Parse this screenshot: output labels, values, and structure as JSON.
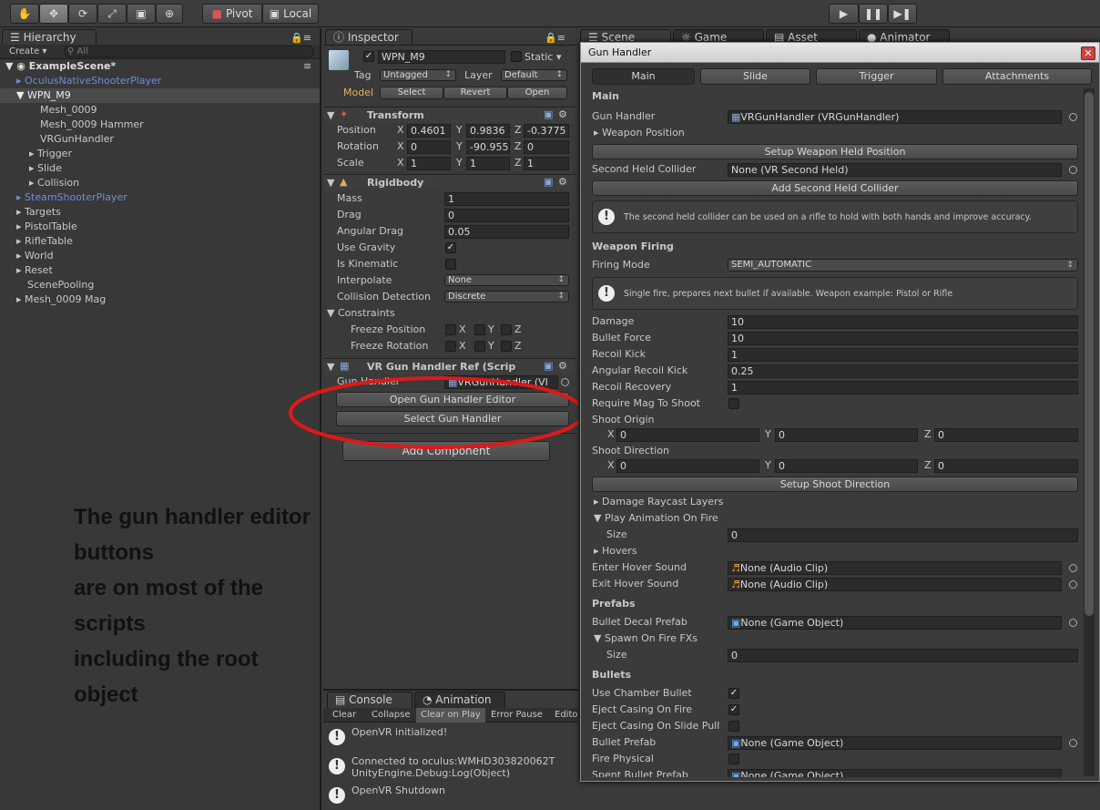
{
  "toolbar": {
    "pivot": "Pivot",
    "local": "Local"
  },
  "hierarchy": {
    "tab": "Hierarchy",
    "create": "Create ▾",
    "search_placeholder": "All",
    "scene": "ExampleScene*",
    "items": [
      "OculusNativeShooterPlayer",
      "WPN_M9",
      "Mesh_0009",
      "Mesh_0009 Hammer",
      "VRGunHandler",
      "Trigger",
      "Slide",
      "Collision",
      "SteamShooterPlayer",
      "Targets",
      "PistolTable",
      "RifleTable",
      "World",
      "Reset",
      "ScenePooling",
      "Mesh_0009 Mag"
    ]
  },
  "inspector": {
    "tab": "Inspector",
    "object_name": "WPN_M9",
    "static": "Static",
    "tag_label": "Tag",
    "tag_value": "Untagged",
    "layer_label": "Layer",
    "layer_value": "Default",
    "model": "Model",
    "select": "Select",
    "revert": "Revert",
    "open": "Open",
    "transform": {
      "title": "Transform",
      "position": "Position",
      "rotation": "Rotation",
      "scale": "Scale",
      "px": "0.4601",
      "py": "0.9836",
      "pz": "-0.3775",
      "rx": "0",
      "ry": "-90.955",
      "rz": "0",
      "sx": "1",
      "sy": "1",
      "sz": "1",
      "x": "X",
      "y": "Y",
      "z": "Z"
    },
    "rigidbody": {
      "title": "Rigidbody",
      "mass": "Mass",
      "mass_v": "1",
      "drag": "Drag",
      "drag_v": "0",
      "angular_drag": "Angular Drag",
      "angular_drag_v": "0.05",
      "use_gravity": "Use Gravity",
      "is_kinematic": "Is Kinematic",
      "interpolate": "Interpolate",
      "interpolate_v": "None",
      "collision": "Collision Detection",
      "collision_v": "Discrete",
      "constraints": "Constraints",
      "freeze_pos": "Freeze Position",
      "freeze_rot": "Freeze Rotation"
    },
    "ref": {
      "title": "VR Gun Handler Ref (Scrip",
      "gun_handler": "Gun Handler",
      "gun_handler_v": "VRGunHandler (VI",
      "open_editor": "Open Gun Handler Editor",
      "select_handler": "Select Gun Handler"
    },
    "add_component": "Add Component"
  },
  "annotation": {
    "line1": "The gun handler editor buttons",
    "line2": "are on most of the scripts",
    "line3": "including the root object"
  },
  "console": {
    "tab1": "Console",
    "tab2": "Animation",
    "clear": "Clear",
    "collapse": "Collapse",
    "clear_on_play": "Clear on Play",
    "error_pause": "Error Pause",
    "editor": "Edito",
    "msg1": "OpenVR initialized!",
    "msg2a": "Connected to oculus:WMHD303820062T",
    "msg2b": "UnityEngine.Debug:Log(Object)",
    "msg3": "OpenVR Shutdown"
  },
  "scene_tabs": {
    "scene": "Scene",
    "game": "Game",
    "asset_store": "Asset Store",
    "animator": "Animator"
  },
  "gun_window": {
    "title": "Gun Handler",
    "tabs": [
      "Main",
      "Slide",
      "Trigger",
      "Attachments"
    ],
    "main_header": "Main",
    "gun_handler": "Gun Handler",
    "gun_handler_v": "VRGunHandler (VRGunHandler)",
    "weapon_position": "Weapon Position",
    "setup_weapon": "Setup Weapon Held Position",
    "second_collider": "Second Held Collider",
    "second_collider_v": "None (VR Second Held)",
    "add_second": "Add Second Held Collider",
    "help1": "The second held collider can be used on a rifle to hold with both hands and improve accuracy.",
    "firing_header": "Weapon Firing",
    "firing_mode": "Firing Mode",
    "firing_mode_v": "SEMI_AUTOMATIC",
    "help2": "Single fire, prepares next bullet if available. Weapon example: Pistol or Rifle",
    "damage": "Damage",
    "damage_v": "10",
    "bullet_force": "Bullet Force",
    "bullet_force_v": "10",
    "recoil_kick": "Recoil Kick",
    "recoil_kick_v": "1",
    "angular_recoil": "Angular Recoil Kick",
    "angular_recoil_v": "0.25",
    "recoil_recovery": "Recoil Recovery",
    "recoil_recovery_v": "1",
    "require_mag": "Require Mag To Shoot",
    "shoot_origin": "Shoot Origin",
    "shoot_direction": "Shoot Direction",
    "zero": "0",
    "setup_shoot": "Setup Shoot Direction",
    "damage_layers": "Damage Raycast Layers",
    "play_anim": "Play Animation On Fire",
    "size": "Size",
    "hovers": "Hovers",
    "enter_hover": "Enter Hover Sound",
    "exit_hover": "Exit Hover Sound",
    "audio_none": "None (Audio Clip)",
    "prefabs_header": "Prefabs",
    "bullet_decal": "Bullet Decal Prefab",
    "go_none": "None (Game Object)",
    "spawn_fx": "Spawn On Fire FXs",
    "bullets_header": "Bullets",
    "chamber": "Use Chamber Bullet",
    "eject_fire": "Eject Casing On Fire",
    "eject_slide": "Eject Casing On Slide Pull",
    "bullet_prefab": "Bullet Prefab",
    "fire_physical": "Fire Physical",
    "spent_prefab": "Spent Bullet Prefab"
  }
}
